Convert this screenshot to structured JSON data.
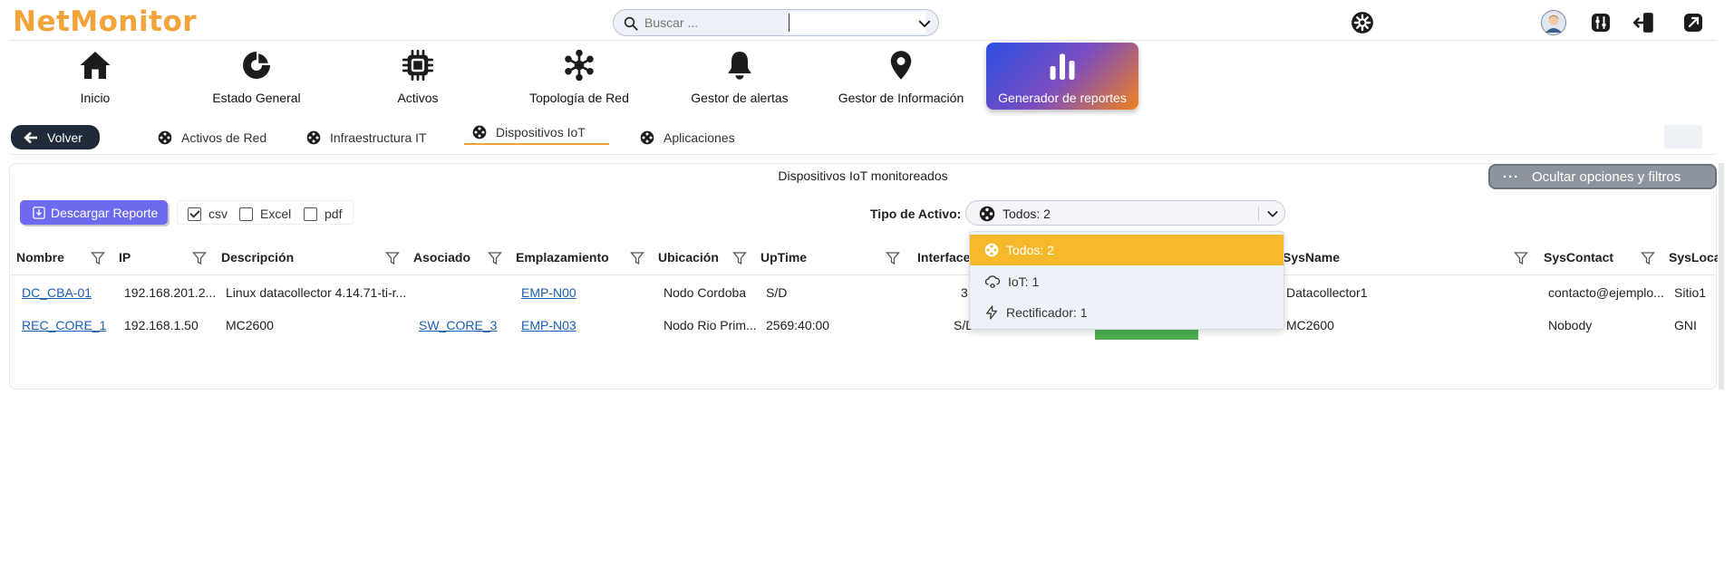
{
  "app": {
    "logo_text": "NetMonitor"
  },
  "search": {
    "placeholder": "Buscar ...",
    "value": ""
  },
  "header_icons": [
    "gear-icon",
    "user-avatar",
    "sliders-icon",
    "logout-icon",
    "external-link-icon"
  ],
  "nav": {
    "items": [
      {
        "label": "Inicio",
        "icon": "home-icon"
      },
      {
        "label": "Estado General",
        "icon": "pie-chart-icon"
      },
      {
        "label": "Activos",
        "icon": "chip-icon"
      },
      {
        "label": "Topología de Red",
        "icon": "network-icon"
      },
      {
        "label": "Gestor de alertas",
        "icon": "bell-icon"
      },
      {
        "label": "Gestor de Información",
        "icon": "map-pin-icon"
      },
      {
        "label": "Generador de reportes",
        "icon": "bar-chart-icon"
      }
    ],
    "active": "Generador de reportes"
  },
  "subnav": {
    "back_label": "Volver",
    "tabs": [
      {
        "label": "Activos de Red"
      },
      {
        "label": "Infraestructura IT"
      },
      {
        "label": "Dispositivos IoT"
      },
      {
        "label": "Aplicaciones"
      }
    ],
    "active": "Dispositivos IoT"
  },
  "panel": {
    "title": "Dispositivos IoT monitoreados",
    "options_label": "Ocultar opciones y filtros",
    "download_label": "Descargar Reporte",
    "formats": [
      {
        "label": "csv",
        "checked": true
      },
      {
        "label": "Excel",
        "checked": false
      },
      {
        "label": "pdf",
        "checked": false
      }
    ],
    "asset_type_label": "Tipo de Activo:",
    "asset_type_value": "Todos: 2"
  },
  "dropdown": {
    "options": [
      {
        "label": "Todos: 2",
        "icon": "network-icon",
        "selected": true
      },
      {
        "label": "IoT: 1",
        "icon": "cloud-icon",
        "selected": false
      },
      {
        "label": "Rectificador: 1",
        "icon": "bolt-icon",
        "selected": false
      }
    ]
  },
  "table": {
    "columns": [
      "Nombre",
      "IP",
      "Descripción",
      "Asociado",
      "Emplazamiento",
      "Ubicación",
      "UpTime",
      "Interfaces",
      "SysName",
      "SysContact",
      "SysLocation"
    ],
    "rows": [
      {
        "nombre": "DC_CBA-01",
        "ip": "192.168.201.2...",
        "descripcion": "Linux datacollector 4.14.71-ti-r...",
        "asociado": "",
        "emplazamiento": "EMP-N00",
        "ubicacion": "Nodo Cordoba",
        "uptime": "S/D",
        "interfaces": "3",
        "sysname": "Datacollector1",
        "syscontact": "contacto@ejemplo...",
        "syslocation": "Sitio1"
      },
      {
        "nombre": "REC_CORE_1",
        "ip": "192.168.1.50",
        "descripcion": "MC2600",
        "asociado": "SW_CORE_3",
        "emplazamiento": "EMP-N03",
        "ubicacion": "Nodo Rio Prim...",
        "uptime": "2569:40:00",
        "interfaces": "S/D",
        "sysname": "MC2600",
        "syscontact": "Nobody",
        "syslocation": "GNI"
      }
    ]
  },
  "colors": {
    "accent": "#f2a33a",
    "download_button": "#6d6af0",
    "dropdown_selected": "#f5b92b",
    "status_green": "#4caf50"
  }
}
